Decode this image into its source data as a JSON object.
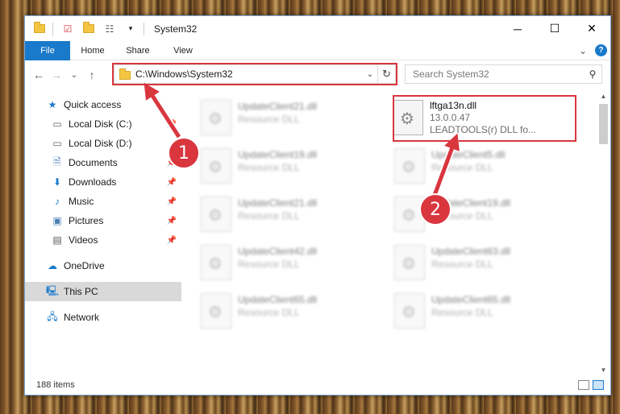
{
  "window": {
    "title": "System32",
    "controls": {
      "minimize": "─",
      "maximize": "☐",
      "close": "✕"
    }
  },
  "ribbon": {
    "tabs": [
      {
        "label": "File"
      },
      {
        "label": "Home"
      },
      {
        "label": "Share"
      },
      {
        "label": "View"
      }
    ],
    "expand_glyph": "⌄",
    "help_glyph": "?"
  },
  "navigation": {
    "back": "←",
    "forward": "→",
    "recent": "⌄",
    "up": "↑",
    "address": "C:\\Windows\\System32",
    "address_dropdown": "⌄",
    "refresh": "↻",
    "search_placeholder": "Search System32"
  },
  "sidebar": {
    "quick_access": "Quick access",
    "items": [
      {
        "label": "Local Disk (C:)",
        "icon": "drive-icon"
      },
      {
        "label": "Local Disk (D:)",
        "icon": "drive-icon"
      },
      {
        "label": "Documents",
        "icon": "documents-icon"
      },
      {
        "label": "Downloads",
        "icon": "downloads-icon"
      },
      {
        "label": "Music",
        "icon": "music-icon"
      },
      {
        "label": "Pictures",
        "icon": "pictures-icon"
      },
      {
        "label": "Videos",
        "icon": "videos-icon"
      }
    ],
    "onedrive": "OneDrive",
    "this_pc": "This PC",
    "network": "Network"
  },
  "files": {
    "left": [
      {
        "name": "UpdateClient21.dll",
        "type": "Resource DLL"
      },
      {
        "name": "UpdateClient19.dll",
        "type": "Resource DLL"
      },
      {
        "name": "UpdateClient21.dll",
        "type": "Resource DLL"
      },
      {
        "name": "UpdateClient42.dll",
        "type": "Resource DLL"
      },
      {
        "name": "UpdateClient65.dll",
        "type": "Resource DLL"
      }
    ],
    "highlighted": {
      "name": "lftga13n.dll",
      "version": "13.0.0.47",
      "description": "LEADTOOLS(r) DLL fo..."
    },
    "right": [
      {
        "name": "UpdateClient5.dll",
        "type": "Resource DLL"
      },
      {
        "name": "UpdateClient19.dll",
        "type": "Resource DLL"
      },
      {
        "name": "UpdateClient63.dll",
        "type": "Resource DLL"
      },
      {
        "name": "UpdateClient65.dll",
        "type": "Resource DLL"
      }
    ]
  },
  "status": {
    "items": "188 items"
  },
  "callouts": {
    "first": "1",
    "second": "2"
  },
  "colors": {
    "accent": "#1979ca",
    "highlight_red": "#d9363e"
  }
}
